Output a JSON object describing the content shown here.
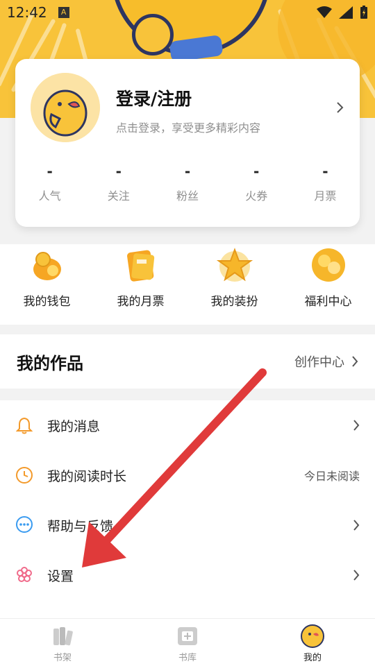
{
  "status_bar": {
    "time": "12:42",
    "app_badge": "A"
  },
  "profile": {
    "title": "登录/注册",
    "subtitle": "点击登录，享受更多精彩内容",
    "stats": [
      {
        "value": "-",
        "label": "人气"
      },
      {
        "value": "-",
        "label": "关注"
      },
      {
        "value": "-",
        "label": "粉丝"
      },
      {
        "value": "-",
        "label": "火券"
      },
      {
        "value": "-",
        "label": "月票"
      }
    ]
  },
  "quick_actions": [
    {
      "label": "我的钱包",
      "icon": "wallet-coins-icon"
    },
    {
      "label": "我的月票",
      "icon": "monthly-ticket-icon"
    },
    {
      "label": "我的装扮",
      "icon": "star-dressup-icon"
    },
    {
      "label": "福利中心",
      "icon": "gift-coins-icon"
    }
  ],
  "works": {
    "title": "我的作品",
    "link_label": "创作中心"
  },
  "menu": [
    {
      "label": "我的消息",
      "icon": "bell-icon",
      "right": ""
    },
    {
      "label": "我的阅读时长",
      "icon": "clock-icon",
      "right": "今日未阅读"
    },
    {
      "label": "帮助与反馈",
      "icon": "chat-bubble-icon",
      "right": ""
    },
    {
      "label": "设置",
      "icon": "gear-flower-icon",
      "right": ""
    }
  ],
  "bottom_nav": [
    {
      "label": "书架",
      "icon": "bookshelf-icon",
      "active": false
    },
    {
      "label": "书库",
      "icon": "library-icon",
      "active": false
    },
    {
      "label": "我的",
      "icon": "profile-avatar-icon",
      "active": true
    }
  ],
  "colors": {
    "brand_yellow": "#f8c33a",
    "arrow_red": "#e03a3a",
    "icon_orange": "#f39a2b",
    "icon_blue": "#3a9bf0",
    "icon_pink": "#f06a8a"
  }
}
